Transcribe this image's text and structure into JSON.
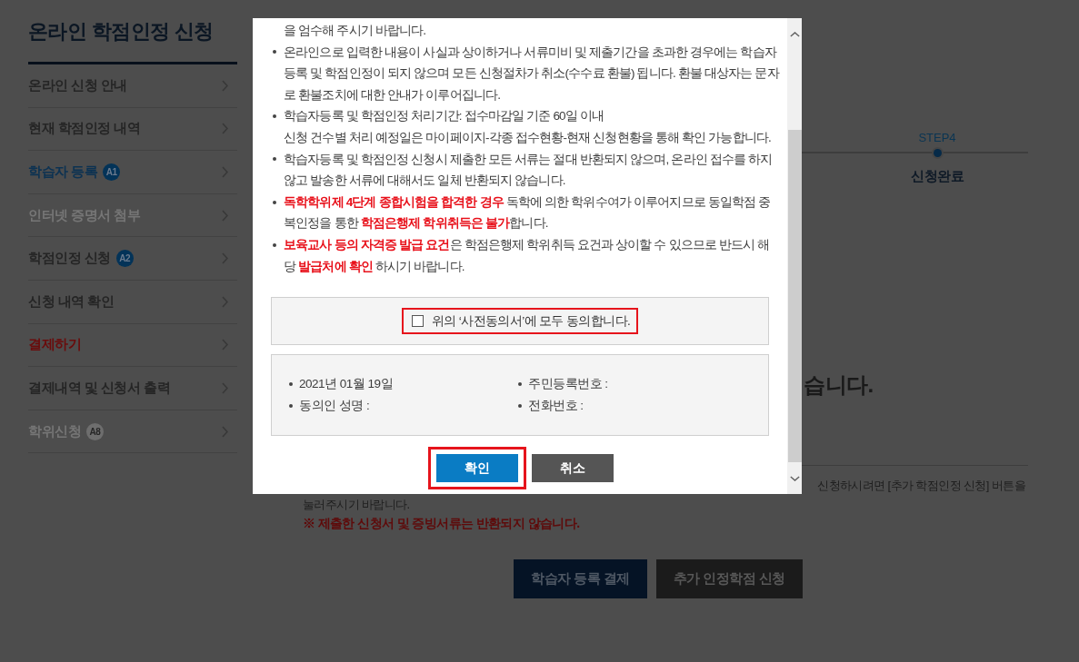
{
  "sidebar": {
    "title": "온라인 학점인정 신청",
    "items": [
      {
        "label": "온라인 신청 안내",
        "selected": false,
        "disabled": false,
        "completed": false
      },
      {
        "label": "현재 학점인정 내역",
        "selected": false,
        "disabled": false,
        "completed": false
      },
      {
        "label": "학습자 등록",
        "badge": "A1",
        "selected": false,
        "disabled": false,
        "completed": true
      },
      {
        "label": "인터넷 증명서 첨부",
        "selected": false,
        "disabled": true,
        "completed": false
      },
      {
        "label": "학점인정 신청",
        "badge": "A2",
        "selected": false,
        "disabled": false,
        "completed": false
      },
      {
        "label": "신청 내역 확인",
        "selected": false,
        "disabled": false,
        "completed": false
      },
      {
        "label": "결제하기",
        "selected": true,
        "disabled": false,
        "completed": false
      },
      {
        "label": "결제내역 및 신청서 출력",
        "selected": false,
        "disabled": false,
        "completed": false
      },
      {
        "label": "학위신청",
        "badge": "A8",
        "selected": false,
        "disabled": true,
        "completed": false
      }
    ]
  },
  "progress": {
    "steps": [
      {
        "label": "STEP4",
        "name": "신청완료",
        "selected": true
      }
    ]
  },
  "result": {
    "heading": "습니다.",
    "notice_lines": [
      "신청하시려면 [추가 학점인정 신청] 버튼을",
      "눌러주시기 바랍니다."
    ],
    "warning": "※ 제출한 신청서 및 증빙서류는 반환되지 않습니다.",
    "buttons": [
      {
        "label": "학습자 등록 결제",
        "kind": "primary"
      },
      {
        "label": "추가 인정학점 신청",
        "kind": "secondary"
      }
    ]
  },
  "dialog": {
    "notes": [
      {
        "kind": "continuation",
        "text": "을 엄수해 주시기 바랍니다."
      },
      {
        "kind": "bullet",
        "text": "온라인으로 입력한 내용이 사실과 상이하거나 서류미비 및 제출기간을 초과한 경우에는 학습자 등록 및 학점인정이 되지 않으며 모든 신청절차가 취소(수수료 환불) 됩니다. 환불 대상자는 문자로 환불조치에 대한 안내가 이루어집니다."
      },
      {
        "kind": "bullet",
        "text": "학습자등록 및 학점인정 처리기간: 접수마감일 기준 60일 이내"
      },
      {
        "kind": "continuation",
        "text": "신청 건수별 처리 예정일은 마이페이지-각종 접수현황-현재 신청현황을 통해 확인 가능합니다."
      },
      {
        "kind": "bullet",
        "text": "학습자등록 및 학점인정 신청시 제출한 모든 서류는 절대 반환되지 않으며, 온라인 접수를 하지 않고 발송한 서류에 대해서도 일체 반환되지 않습니다."
      },
      {
        "kind": "bullet",
        "text": "**독학학위제 4단계 종합시험을 합격한 경우** 독학에 의한 학위수여가 이루어지므로 동일학점 중복인정을 통한 **학점은행제 학위취득은 불가**합니다."
      },
      {
        "kind": "bullet",
        "text": "**보육교사 등의 자격증 발급 요건**은 학점은행제 학위취득 요건과 상이할 수 있으므로 반드시 해당 **발급처에 확인** 하시기 바랍니다."
      }
    ],
    "agreement": {
      "label": "위의 ‘사전동의서’에 모두 동의합니다.",
      "checked": false,
      "highlighted": true
    },
    "info": [
      "2021년 01월 19일",
      "주민등록번호 :",
      "동의인 성명 :",
      "전화번호 :"
    ],
    "buttons": [
      {
        "label": "확인",
        "kind": "primary",
        "highlighted": true
      },
      {
        "label": "취소",
        "kind": "secondary",
        "highlighted": false
      }
    ]
  }
}
